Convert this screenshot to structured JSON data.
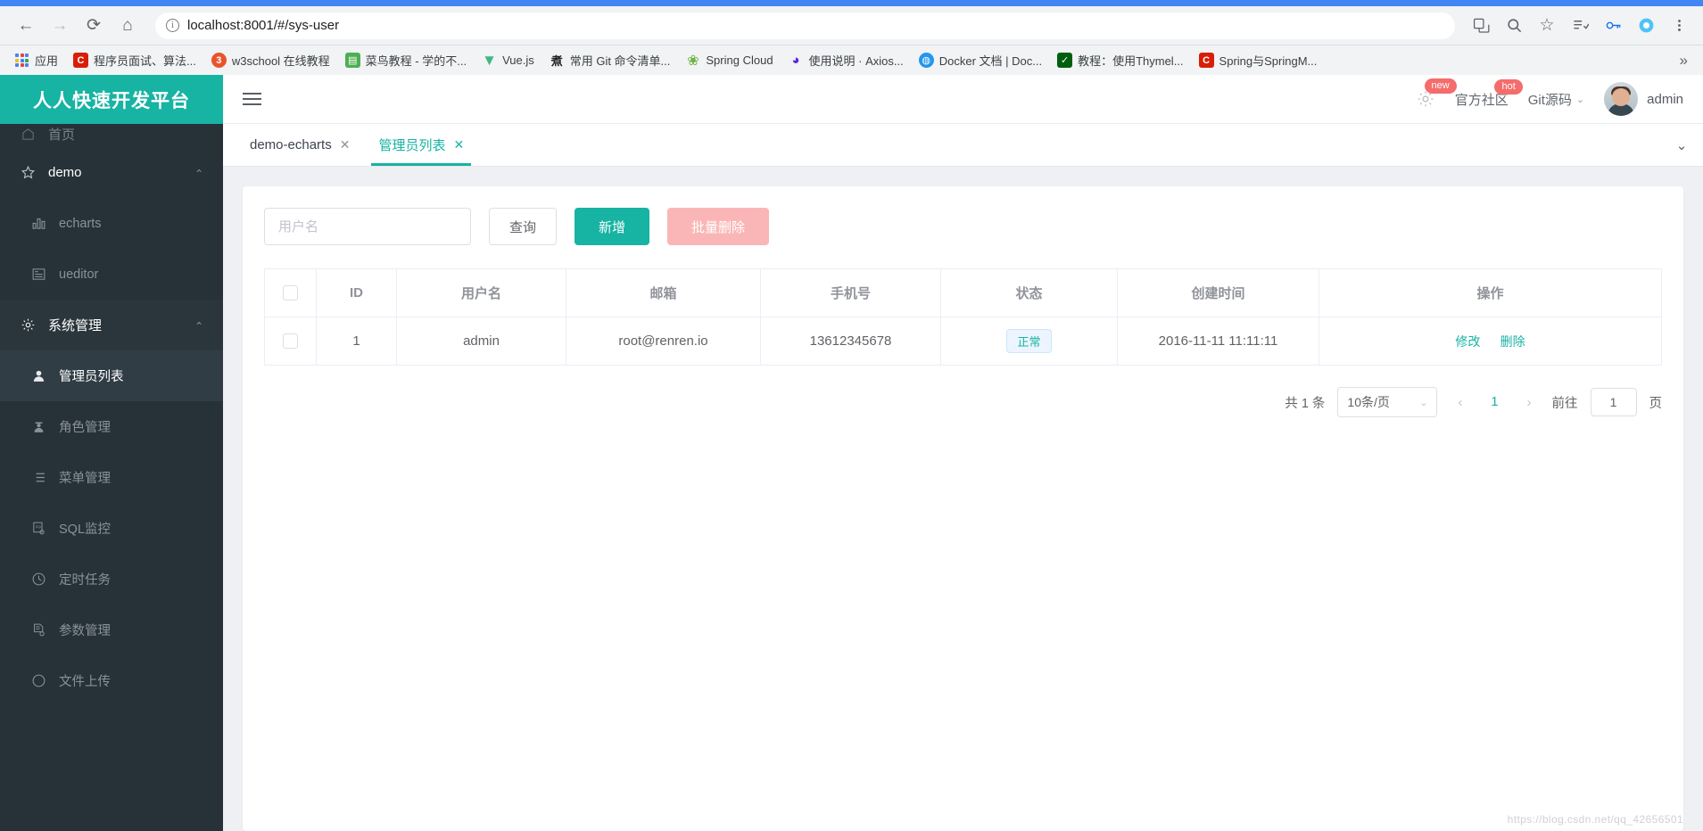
{
  "browser": {
    "url": "localhost:8001/#/sys-user",
    "nav": {
      "back": "←",
      "forward": "→",
      "reload": "⟳",
      "home": "⌂"
    },
    "bookmarks": [
      {
        "label": "应用",
        "icon": "apps-grid-icon",
        "color": ""
      },
      {
        "label": "程序员面试、算法...",
        "icon": "csdn-icon",
        "color": "#d81e06"
      },
      {
        "label": "w3school 在线教程",
        "icon": "w3school-icon",
        "color": "#e8552d"
      },
      {
        "label": "菜鸟教程 - 学的不...",
        "icon": "runoob-icon",
        "color": "#4caf50"
      },
      {
        "label": "Vue.js",
        "icon": "vue-icon",
        "color": "#41b883"
      },
      {
        "label": "常用 Git 命令清单...",
        "icon": "ruanyf-icon",
        "color": "#333333"
      },
      {
        "label": "Spring Cloud",
        "icon": "spring-icon",
        "color": "#6db33f"
      },
      {
        "label": "使用说明 · Axios...",
        "icon": "axios-icon",
        "color": "#5a29e4"
      },
      {
        "label": "Docker 文档 | Doc...",
        "icon": "docker-icon",
        "color": "#2496ed"
      },
      {
        "label": "教程：使用Thymel...",
        "icon": "thymeleaf-icon",
        "color": "#005f0f"
      },
      {
        "label": "Spring与SpringM...",
        "icon": "csdn-icon",
        "color": "#d81e06"
      }
    ],
    "overflow": "»"
  },
  "sidebar": {
    "logo": "人人快速开发平台",
    "items": [
      {
        "label": "首页",
        "icon": "home-icon",
        "level": "top",
        "state": "cut-off"
      },
      {
        "label": "demo",
        "icon": "star-icon",
        "level": "group",
        "state": "expanded"
      },
      {
        "label": "echarts",
        "icon": "bar-chart-icon",
        "level": "child",
        "state": "normal"
      },
      {
        "label": "ueditor",
        "icon": "editor-icon",
        "level": "child",
        "state": "normal"
      },
      {
        "label": "系统管理",
        "icon": "gear-icon",
        "level": "group",
        "state": "expanded"
      },
      {
        "label": "管理员列表",
        "icon": "user-icon",
        "level": "child",
        "state": "active"
      },
      {
        "label": "角色管理",
        "icon": "role-icon",
        "level": "child",
        "state": "normal"
      },
      {
        "label": "菜单管理",
        "icon": "menu-list-icon",
        "level": "child",
        "state": "normal"
      },
      {
        "label": "SQL监控",
        "icon": "sql-icon",
        "level": "child",
        "state": "normal"
      },
      {
        "label": "定时任务",
        "icon": "clock-icon",
        "level": "child",
        "state": "normal"
      },
      {
        "label": "参数管理",
        "icon": "params-icon",
        "level": "child",
        "state": "normal"
      },
      {
        "label": "文件上传",
        "icon": "upload-icon",
        "level": "child",
        "state": "cut-off"
      }
    ],
    "collapse_caret": "⌄"
  },
  "topbar": {
    "hamburger": "menu-icon",
    "settings_icon": "gear-icon",
    "settings_badge": "new",
    "community_label": "官方社区",
    "community_badge": "hot",
    "git_label": "Git源码",
    "git_caret": "⌄",
    "user_name": "admin"
  },
  "tabs": {
    "items": [
      {
        "label": "demo-echarts",
        "active": false,
        "close": "✕"
      },
      {
        "label": "管理员列表",
        "active": true,
        "close": "✕"
      }
    ],
    "more_caret": "⌄"
  },
  "toolbar": {
    "search_placeholder": "用户名",
    "search_value": "",
    "query_label": "查询",
    "add_label": "新增",
    "batch_delete_label": "批量删除"
  },
  "table": {
    "columns": [
      "",
      "ID",
      "用户名",
      "邮箱",
      "手机号",
      "状态",
      "创建时间",
      "操作"
    ],
    "rows": [
      {
        "id": "1",
        "username": "admin",
        "email": "root@renren.io",
        "phone": "13612345678",
        "status": "正常",
        "created": "2016-11-11 11:11:11",
        "edit": "修改",
        "delete": "删除"
      }
    ]
  },
  "pagination": {
    "total_text": "共 1 条",
    "page_size": "10条/页",
    "prev": "‹",
    "next": "›",
    "current_page": "1",
    "jump_prefix": "前往",
    "jump_value": "1",
    "jump_suffix": "页"
  },
  "watermark": "https://blog.csdn.net/qq_42656501",
  "colors": {
    "brand_teal": "#17b3a3",
    "sidebar_dark": "#263238",
    "badge_red": "#f56c6c",
    "disabled_red": "#fab6b6",
    "browser_blue": "#4285f4"
  }
}
